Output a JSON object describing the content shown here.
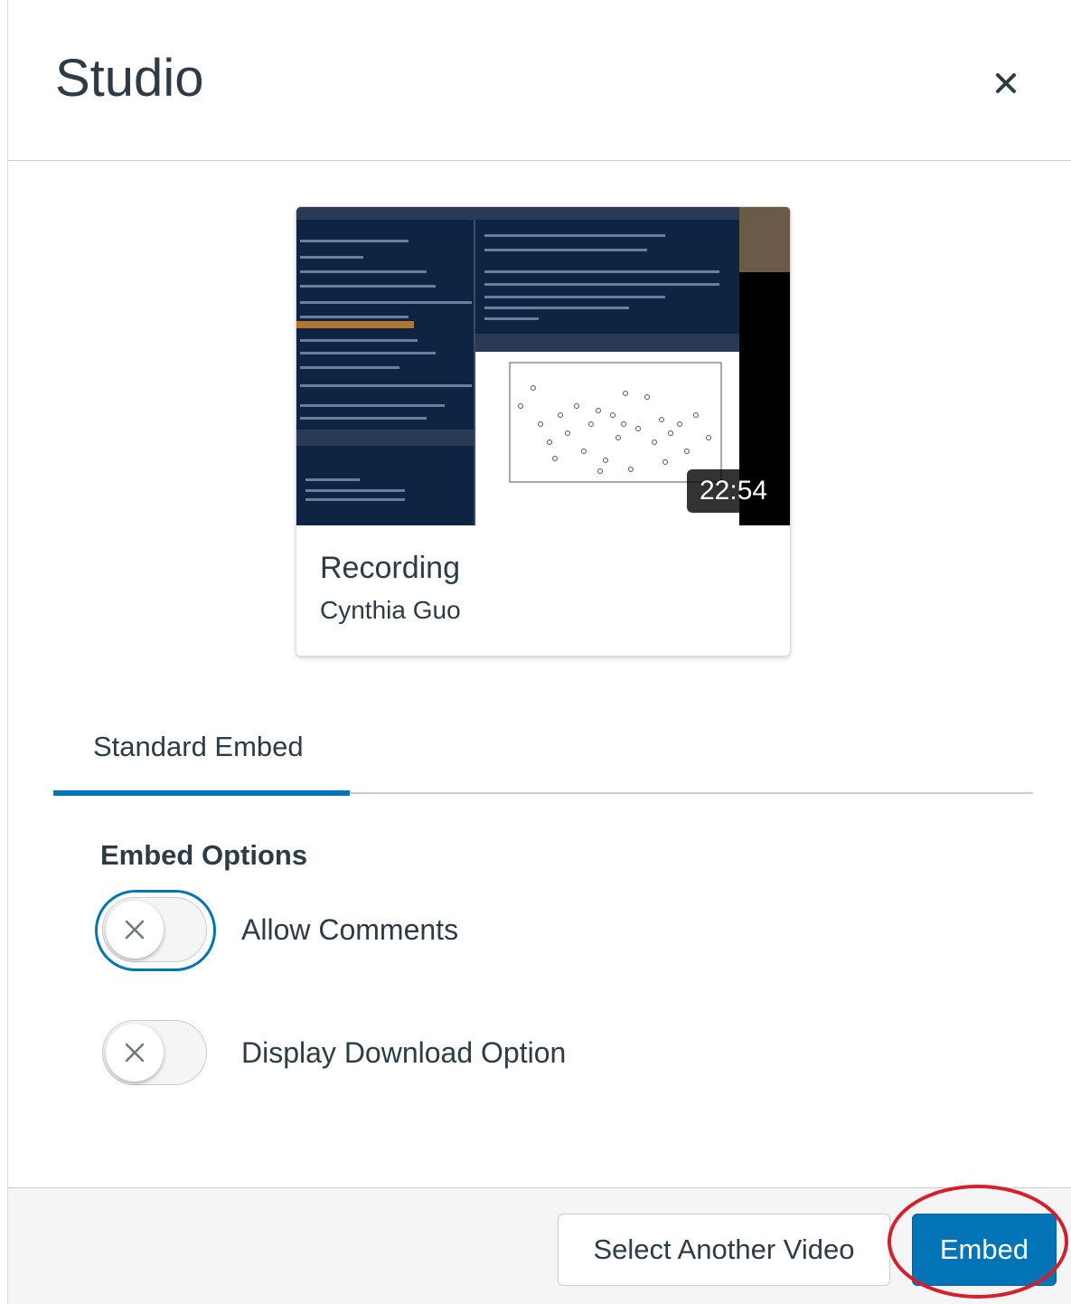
{
  "header": {
    "title": "Studio",
    "close_glyph": "×"
  },
  "video": {
    "title": "Recording",
    "author": "Cynthia Guo",
    "duration": "22:54"
  },
  "tabs": [
    {
      "label": "Standard Embed",
      "active": true
    }
  ],
  "options": {
    "heading": "Embed Options",
    "toggles": [
      {
        "label": "Allow Comments",
        "checked": false,
        "focused": true,
        "icon": "x-icon"
      },
      {
        "label": "Display Download Option",
        "checked": false,
        "focused": false,
        "icon": "x-icon"
      }
    ]
  },
  "footer": {
    "secondary_label": "Select Another Video",
    "primary_label": "Embed"
  },
  "colors": {
    "primary": "#0374b5",
    "text": "#2d3b45",
    "annotation": "#d3202a"
  }
}
